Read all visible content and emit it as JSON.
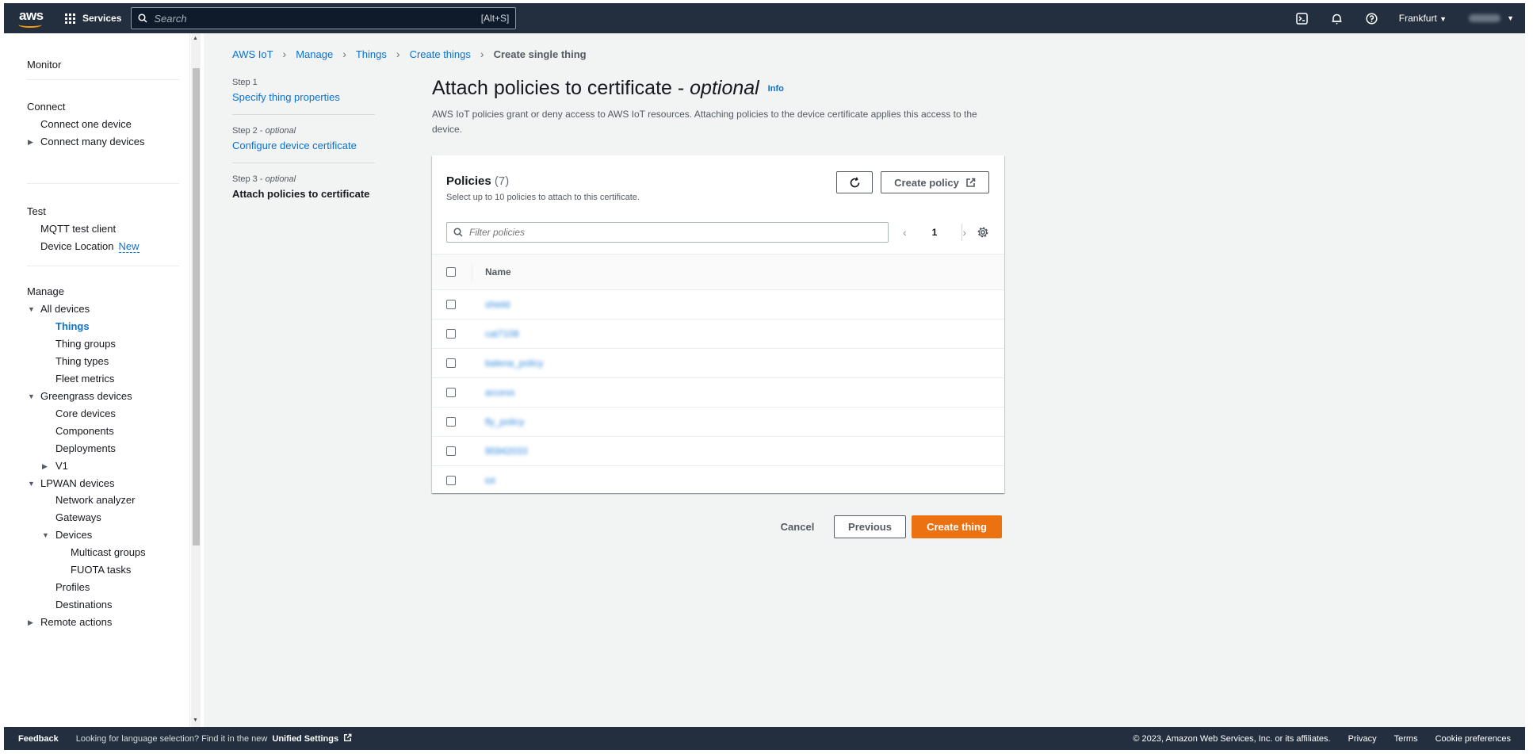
{
  "topnav": {
    "logo_text": "aws",
    "services_label": "Services",
    "search_placeholder": "Search",
    "search_shortcut": "[Alt+S]",
    "region": "Frankfurt"
  },
  "leftnav": {
    "monitor": "Monitor",
    "connect": "Connect",
    "connect_one": "Connect one device",
    "connect_many": "Connect many devices",
    "test": "Test",
    "mqtt": "MQTT test client",
    "device_location": "Device Location",
    "new_badge": "New",
    "manage": "Manage",
    "all_devices": "All devices",
    "things": "Things",
    "thing_groups": "Thing groups",
    "thing_types": "Thing types",
    "fleet_metrics": "Fleet metrics",
    "greengrass": "Greengrass devices",
    "core_devices": "Core devices",
    "components": "Components",
    "deployments": "Deployments",
    "v1": "V1",
    "lpwan": "LPWAN devices",
    "network_analyzer": "Network analyzer",
    "gateways": "Gateways",
    "devices": "Devices",
    "multicast": "Multicast groups",
    "fuota": "FUOTA tasks",
    "profiles": "Profiles",
    "destinations": "Destinations",
    "remote_actions": "Remote actions"
  },
  "breadcrumb": {
    "items": [
      "AWS IoT",
      "Manage",
      "Things",
      "Create things"
    ],
    "current": "Create single thing"
  },
  "steps": [
    {
      "num": "Step 1",
      "optional": "",
      "label": "Specify thing properties"
    },
    {
      "num": "Step 2 - ",
      "optional": "optional",
      "label": "Configure device certificate"
    },
    {
      "num": "Step 3 - ",
      "optional": "optional",
      "label": "Attach policies to certificate"
    }
  ],
  "page": {
    "title": "Attach policies to certificate - ",
    "title_optional": "optional",
    "info": "Info",
    "description": "AWS IoT policies grant or deny access to AWS IoT resources. Attaching policies to the device certificate applies this access to the device."
  },
  "policies": {
    "title": "Policies",
    "count": "(7)",
    "description": "Select up to 10 policies to attach to this certificate.",
    "create_policy": "Create policy",
    "filter_placeholder": "Filter policies",
    "page": "1",
    "column_name": "Name",
    "rows": [
      "shield",
      "cat7108",
      "balena_policy",
      "access",
      "fly_policy",
      "95942033",
      "iot"
    ]
  },
  "actions": {
    "cancel": "Cancel",
    "previous": "Previous",
    "create": "Create thing"
  },
  "footer": {
    "feedback": "Feedback",
    "lang_text": "Looking for language selection? Find it in the new",
    "unified": "Unified Settings",
    "copyright": "© 2023, Amazon Web Services, Inc. or its affiliates.",
    "privacy": "Privacy",
    "terms": "Terms",
    "cookies": "Cookie preferences"
  },
  "colors": {
    "nav_bg": "#232f3e",
    "link": "#0972d3",
    "primary": "#ec7211",
    "page_bg": "#f2f3f3"
  }
}
